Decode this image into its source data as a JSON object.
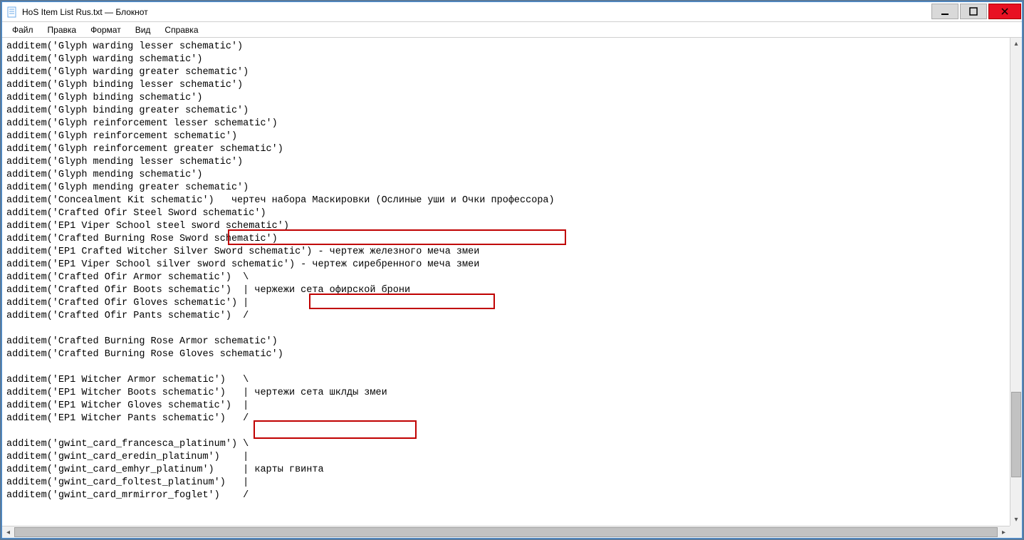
{
  "window": {
    "title": "HoS Item List Rus.txt — Блокнот"
  },
  "menu": {
    "file": "Файл",
    "edit": "Правка",
    "format": "Формат",
    "view": "Вид",
    "help": "Справка"
  },
  "lines": [
    "additem('Glyph warding lesser schematic')",
    "additem('Glyph warding schematic')",
    "additem('Glyph warding greater schematic')",
    "additem('Glyph binding lesser schematic')",
    "additem('Glyph binding schematic')",
    "additem('Glyph binding greater schematic')",
    "additem('Glyph reinforcement lesser schematic')",
    "additem('Glyph reinforcement schematic')",
    "additem('Glyph reinforcement greater schematic')",
    "additem('Glyph mending lesser schematic')",
    "additem('Glyph mending schematic')",
    "additem('Glyph mending greater schematic')",
    "additem('Concealment Kit schematic')   чертеч набора Маскировки (Ослиные уши и Очки профессора)",
    "additem('Crafted Ofir Steel Sword schematic')",
    "additem('EP1 Viper School steel sword schematic')",
    "additem('Crafted Burning Rose Sword schematic')",
    "additem('EP1 Crafted Witcher Silver Sword schematic') - чертеж железного меча змеи",
    "additem('EP1 Viper School silver sword schematic') - чертеж сиребренного меча змеи",
    "additem('Crafted Ofir Armor schematic')  \\",
    "additem('Crafted Ofir Boots schematic')  | чержежи сета офирской брони",
    "additem('Crafted Ofir Gloves schematic') |",
    "additem('Crafted Ofir Pants schematic')  /",
    "",
    "additem('Crafted Burning Rose Armor schematic')",
    "additem('Crafted Burning Rose Gloves schematic')",
    "",
    "additem('EP1 Witcher Armor schematic')   \\",
    "additem('EP1 Witcher Boots schematic')   | чертежи сета шклды змеи",
    "additem('EP1 Witcher Gloves schematic')  |",
    "additem('EP1 Witcher Pants schematic')   /",
    "",
    "additem('gwint_card_francesca_platinum') \\",
    "additem('gwint_card_eredin_platinum')    |",
    "additem('gwint_card_emhyr_platinum')     | карты гвинта",
    "additem('gwint_card_foltest_platinum')   |",
    "additem('gwint_card_mrmirror_foglet')    /"
  ],
  "highlights": {
    "h1": "чертеч набора Маскировки (Ослиные уши и Очки профессора)",
    "h2": "чертеж сиребренного меча змеи",
    "h3": "чертежи сета шклды змеи"
  }
}
